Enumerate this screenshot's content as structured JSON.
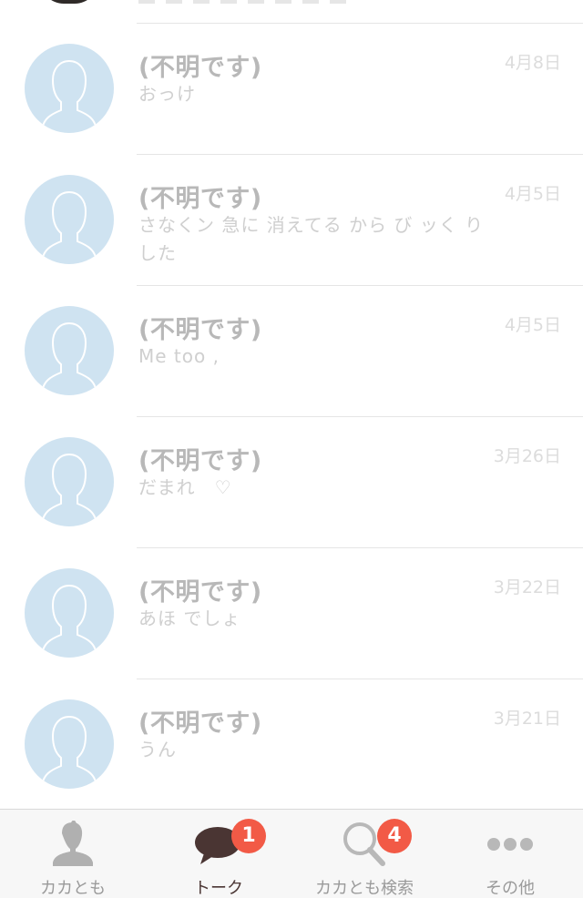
{
  "colors": {
    "accent": "#4a3533",
    "badge": "#f25a46",
    "avatar_bg": "#cfe3f1",
    "inactive_tab": "#9a9a9a"
  },
  "conversations": [
    {
      "name": "(不明です)",
      "message": "おっけ",
      "date": "4月8日"
    },
    {
      "name": "(不明です)",
      "message": "さなくン 急に 消えてる から び ッく りした",
      "date": "4月5日"
    },
    {
      "name": "(不明です)",
      "message": "Me too ,",
      "date": "4月5日"
    },
    {
      "name": "(不明です)",
      "message": "だまれ　♡",
      "date": "3月26日"
    },
    {
      "name": "(不明です)",
      "message": "あほ でしょ",
      "date": "3月22日"
    },
    {
      "name": "(不明です)",
      "message": "うん",
      "date": "3月21日"
    }
  ],
  "tabbar": {
    "friends": {
      "label": "カカとも",
      "icon": "person-icon"
    },
    "talk": {
      "label": "トーク",
      "icon": "speech-bubble-icon",
      "badge": "1"
    },
    "search": {
      "label": "カカとも検索",
      "icon": "search-icon",
      "badge": "4"
    },
    "more": {
      "label": "その他",
      "icon": "more-dots-icon"
    }
  }
}
